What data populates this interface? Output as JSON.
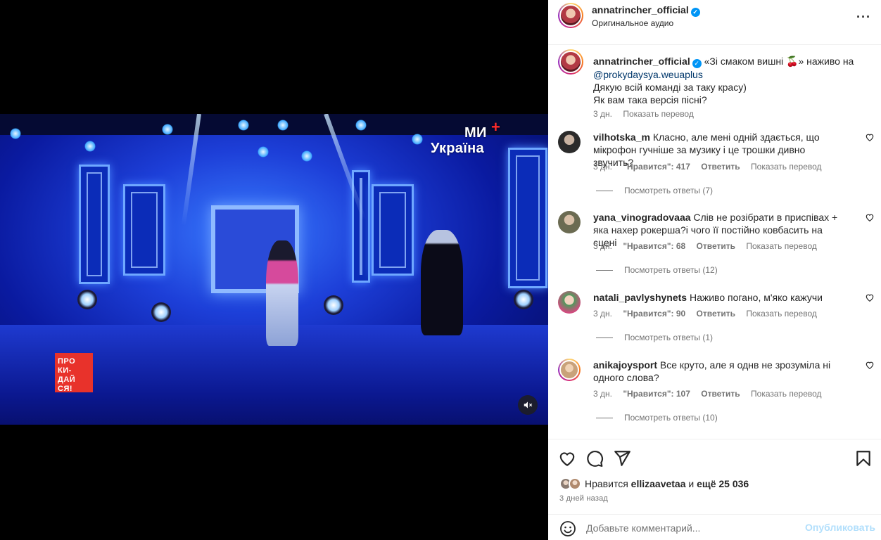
{
  "post": {
    "author": "annatrincher_official",
    "audio": "Оригинальное аудио",
    "more_icon": "more-horizontal-icon"
  },
  "video": {
    "channel_name": "Україна",
    "channel_prefix": "МИ",
    "channel_plus": "+",
    "logo_lines": [
      "ПРО",
      "КИ-",
      "ДАЙ",
      "СЯ!"
    ],
    "mute_icon": "speaker-muted-icon"
  },
  "caption": {
    "author": "annatrincher_official",
    "text_line1": "«Зі смаком вишні 🍒» наживо на",
    "mention": "@prokydaysya.weuaplus",
    "text_line2": "Дякую всій команді за таку красу)",
    "text_line3": "Як вам така версія пісні?",
    "time": "3 дн.",
    "translate": "Показать перевод"
  },
  "comments": [
    {
      "user": "vilhotska_m",
      "text": "Класно, але мені одній здається, що мікрофон гучніше за музику і це трошки дивно звучить?",
      "time": "3 дн.",
      "likes": "\"Нравится\": 417",
      "reply": "Ответить",
      "translate": "Показать перевод",
      "replies": "Посмотреть ответы (7)",
      "avatar_color": "#3a3a3a"
    },
    {
      "user": "yana_vinogradovaaa",
      "text": "Слів не розібрати в приспівах + яка нахер рокерша?і чого її постійно ковбасить на сцені",
      "time": "3 дн.",
      "likes": "\"Нравится\": 68",
      "reply": "Ответить",
      "translate": "Показать перевод",
      "replies": "Посмотреть ответы (12)",
      "avatar_color": "#6b6b52"
    },
    {
      "user": "natali_pavlyshynets",
      "text": "Наживо погано, м'яко кажучи",
      "time": "3 дн.",
      "likes": "\"Нравится\": 90",
      "reply": "Ответить",
      "translate": "Показать перевод",
      "replies": "Посмотреть ответы (1)",
      "avatar_color": "#4f9a5c"
    },
    {
      "user": "anikajoysport",
      "text": "Все круто, але я однв не зрозуміла ні одного слова?",
      "time": "3 дн.",
      "likes": "\"Нравится\": 107",
      "reply": "Ответить",
      "translate": "Показать перевод",
      "replies": "Посмотреть ответы (10)",
      "avatar_color": "#c9a27a"
    }
  ],
  "actions": {
    "like_icon": "heart-icon",
    "comment_icon": "comment-icon",
    "share_icon": "send-icon",
    "save_icon": "bookmark-icon",
    "likes_prefix": "Нравится",
    "likes_user": "ellizaavetaa",
    "likes_middle": "и",
    "likes_rest": "ещё 25 036",
    "posted": "3 дней назад"
  },
  "add_comment": {
    "placeholder": "Добавьте комментарий...",
    "publish": "Опубликовать",
    "emoji_icon": "emoji-smile-icon"
  },
  "colors": {
    "accent": "#0095f6",
    "publish_disabled": "#b2dffc",
    "muted_text": "#737373"
  }
}
